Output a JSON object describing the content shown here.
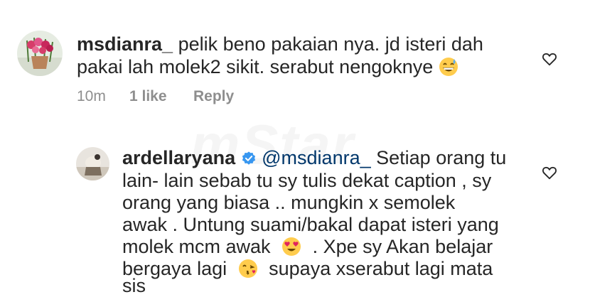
{
  "watermark": "mStar",
  "comment": {
    "username": "msdianra_",
    "lines": [
      "pelik beno pakaian nya. jd isteri dah",
      "pakai lah molek2 sikit. serabut nengoknye"
    ],
    "emoji": "grinning-sweat-emoji",
    "time": "10m",
    "likes": "1 like",
    "reply_label": "Reply",
    "avatar_icon": "flower-pot-avatar",
    "like_icon": "heart-outline-icon"
  },
  "reply": {
    "username": "ardellaryana",
    "verified_icon": "verified-badge-icon",
    "mention": "@msdianra_",
    "line1_rest": "Setiap orang tu",
    "line2": "lain- lain sebab tu sy tulis dekat caption , sy",
    "line3": "orang yang biasa .. mungkin x semolek",
    "line4": "awak . Untung suami/bakal dapat isteri yang",
    "line5a": "molek mcm awak",
    "line5b": ". Xpe sy Akan  belajar",
    "line6a": "bergaya lagi",
    "line6b": "supaya xserabut lagi mata",
    "line7": "sis",
    "emoji1": "heart-eyes-emoji",
    "emoji2": "kissing-heart-emoji",
    "avatar_icon": "user-photo-avatar",
    "like_icon": "heart-outline-icon"
  },
  "colors": {
    "text": "#262626",
    "meta": "#8e8e8e",
    "mention": "#00376b",
    "verified": "#3897f0"
  }
}
